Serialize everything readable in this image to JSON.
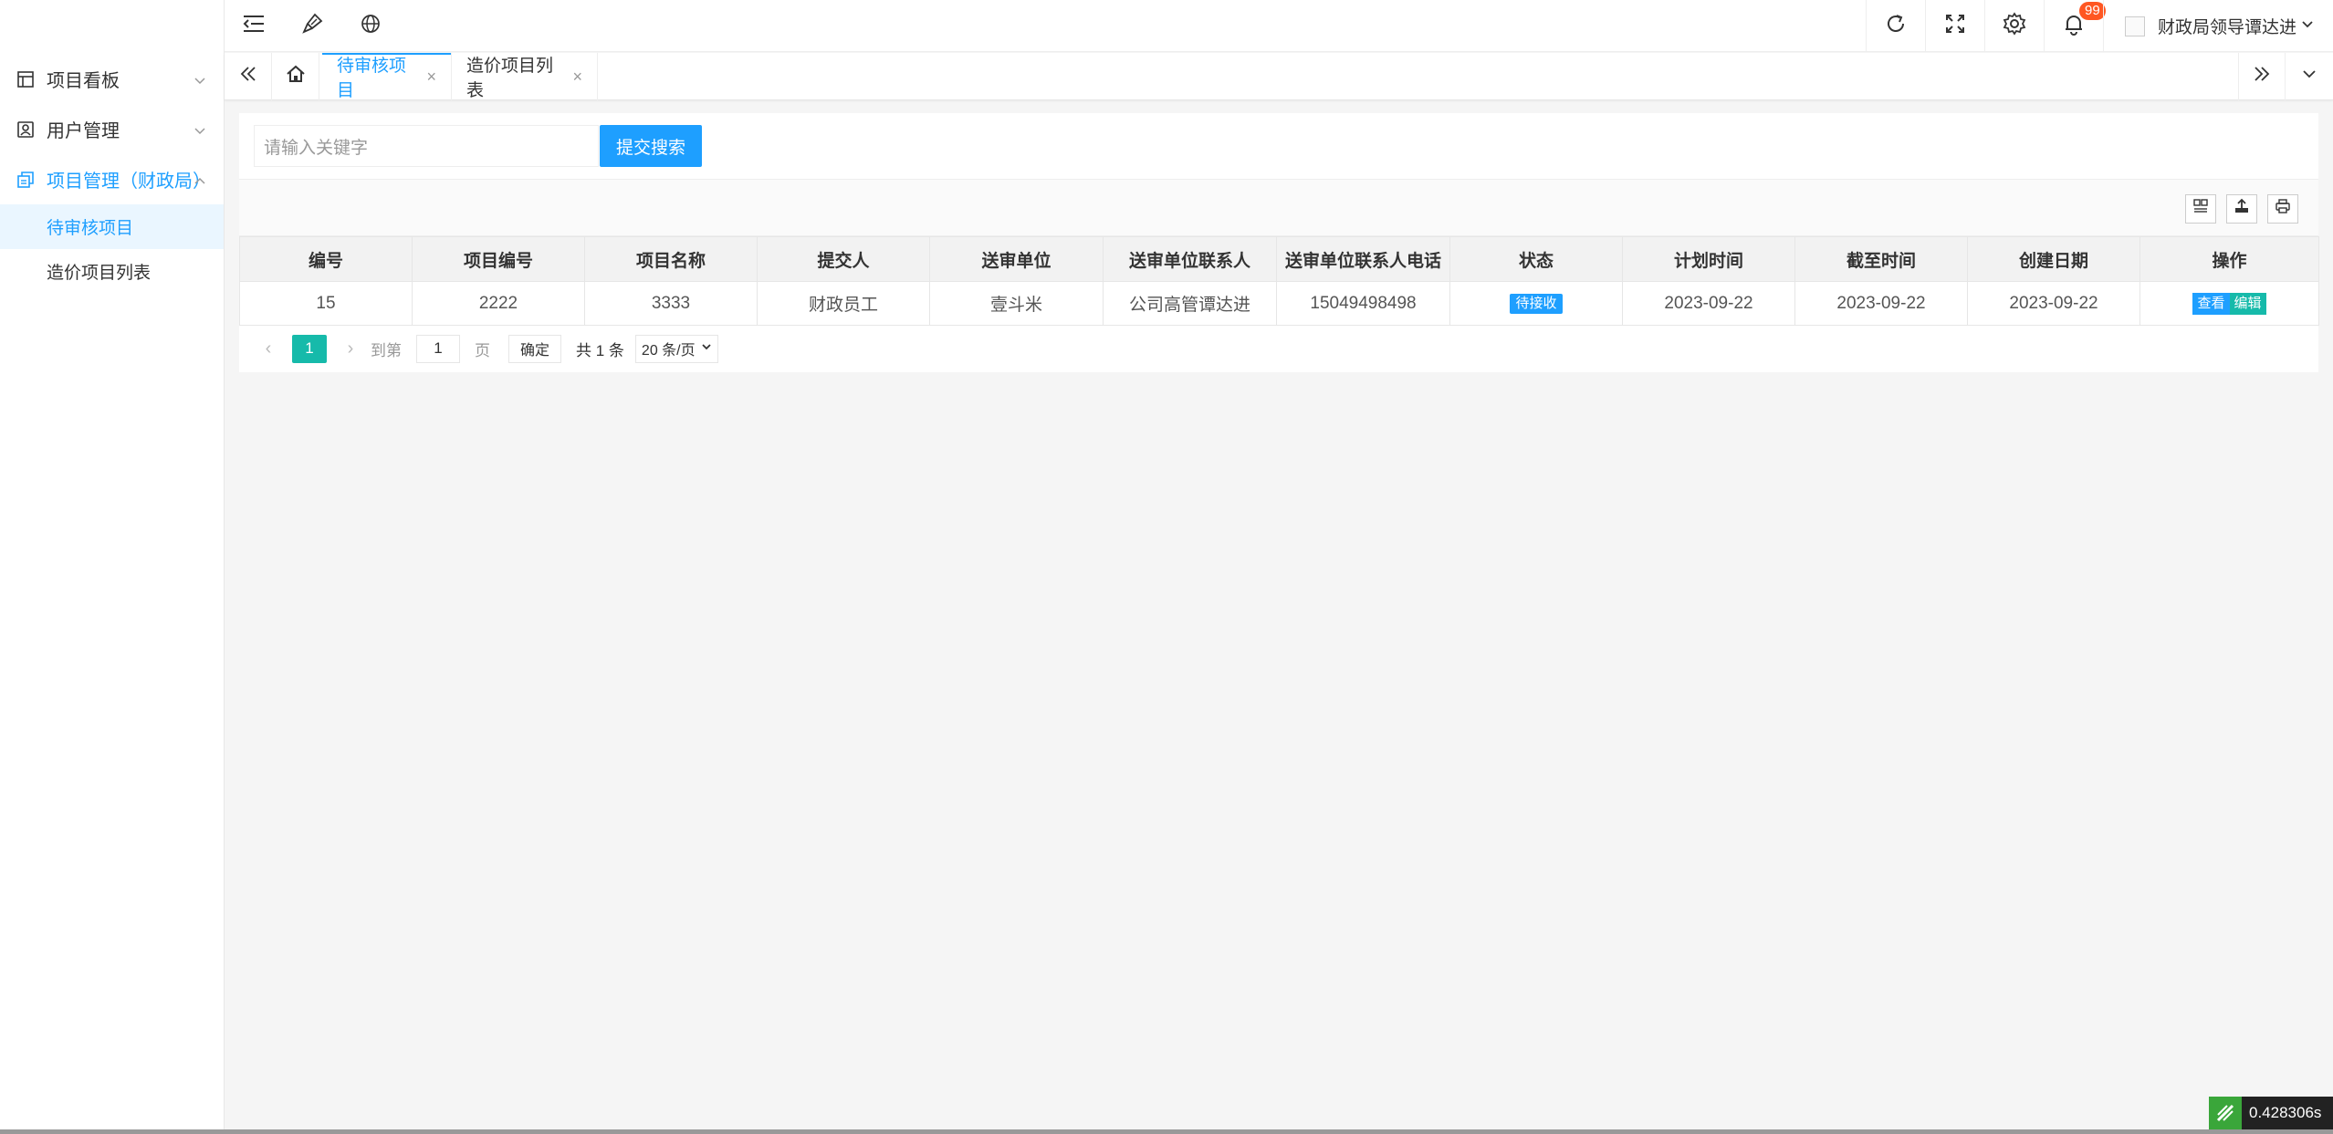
{
  "sidebar": {
    "items": [
      {
        "label": "项目看板",
        "icon": "dashboard-icon"
      },
      {
        "label": "用户管理",
        "icon": "user-card-icon"
      },
      {
        "label": "项目管理（财政局）",
        "icon": "copy-icon",
        "expanded": true,
        "children": [
          {
            "label": "待审核项目",
            "active": true
          },
          {
            "label": "造价项目列表",
            "active": false
          }
        ]
      }
    ]
  },
  "header": {
    "notifications": "99",
    "user_name": "财政局领导谭达进"
  },
  "tabs": [
    {
      "label": "待审核项目",
      "active": true,
      "close": "×"
    },
    {
      "label": "造价项目列表",
      "active": false,
      "close": "×"
    }
  ],
  "search": {
    "placeholder": "请输入关键字",
    "button_label": "提交搜索"
  },
  "table": {
    "columns": [
      "编号",
      "项目编号",
      "项目名称",
      "提交人",
      "送审单位",
      "送审单位联系人",
      "送审单位联系人电话",
      "状态",
      "计划时间",
      "截至时间",
      "创建日期",
      "操作"
    ],
    "rows": [
      {
        "id": "15",
        "project_code": "2222",
        "project_name": "3333",
        "submitter": "财政员工",
        "unit": "壹斗米",
        "contact": "公司高管谭达进",
        "phone": "15049498498",
        "status": "待接收",
        "plan_time": "2023-09-22",
        "deadline": "2023-09-22",
        "created": "2023-09-22",
        "action_view": "查看",
        "action_edit": "编辑"
      }
    ]
  },
  "pager": {
    "current": "1",
    "goto_prefix": "到第",
    "goto_value": "1",
    "goto_suffix": "页",
    "confirm": "确定",
    "total": "共 1 条",
    "page_size": "20 条/页"
  },
  "timer": "0.428306s",
  "colors": {
    "accent": "#1e9fff",
    "teal": "#16baaa",
    "badge": "#ff5722"
  }
}
